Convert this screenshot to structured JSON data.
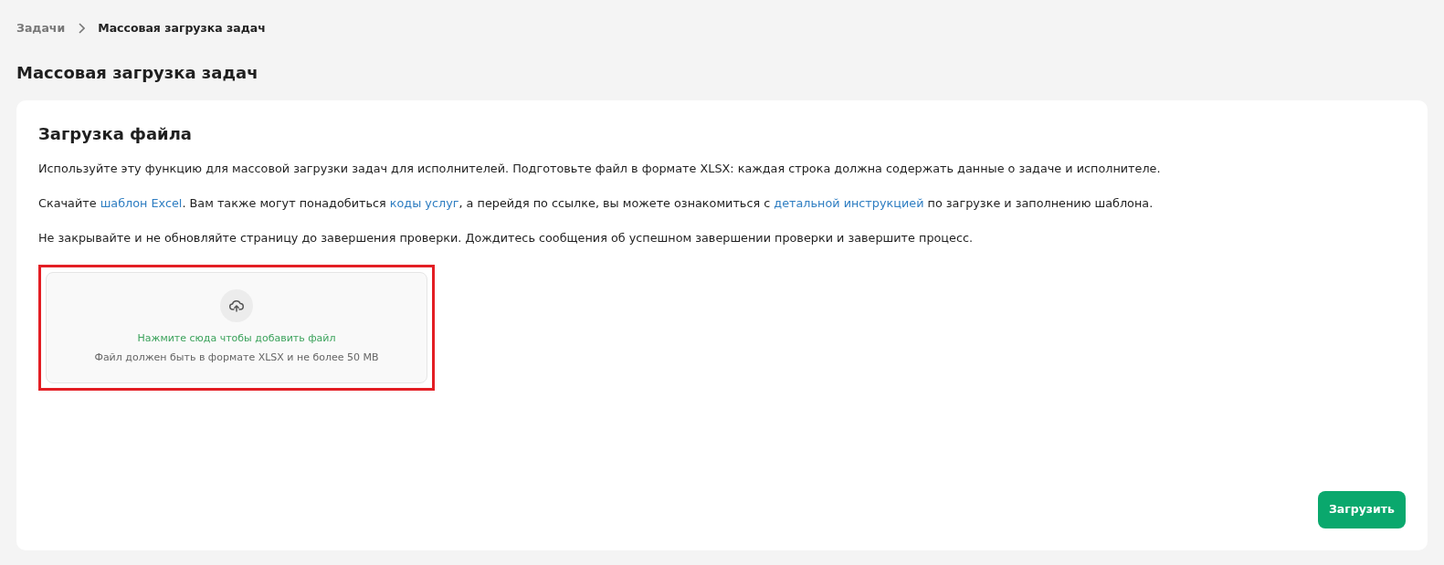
{
  "breadcrumb": [
    {
      "label": "Задачи",
      "current": false
    },
    {
      "label": "Массовая загрузка задач",
      "current": true
    }
  ],
  "page_title": "Массовая загрузка задач",
  "card": {
    "title": "Загрузка файла",
    "paragraphs": [
      [
        {
          "text": "Используйте эту функцию для массовой загрузки задач для исполнителей. Подготовьте файл в формате XLSX: каждая строка должна содержать данные о задаче и исполнителе.",
          "link": false
        }
      ],
      [
        {
          "text": "Скачайте ",
          "link": false
        },
        {
          "text": "шаблон Excel",
          "link": true
        },
        {
          "text": ". Вам также могут понадобиться ",
          "link": false
        },
        {
          "text": "коды услуг",
          "link": true
        },
        {
          "text": ", а перейдя по ссылке, вы можете ознакомиться с ",
          "link": false
        },
        {
          "text": "детальной инструкцией",
          "link": true
        },
        {
          "text": " по загрузке и заполнению шаблона.",
          "link": false
        }
      ],
      [
        {
          "text": "Не закрывайте и не обновляйте страницу до завершения проверки. Дождитесь сообщения об успешном завершении проверки и завершите процесс.",
          "link": false
        }
      ]
    ],
    "dropzone": {
      "action": "Нажмите сюда чтобы добавить файл",
      "hint": "Файл должен быть в формате XLSX и не более 50 MB",
      "highlighted": true
    },
    "submit_button": "Загрузить"
  }
}
